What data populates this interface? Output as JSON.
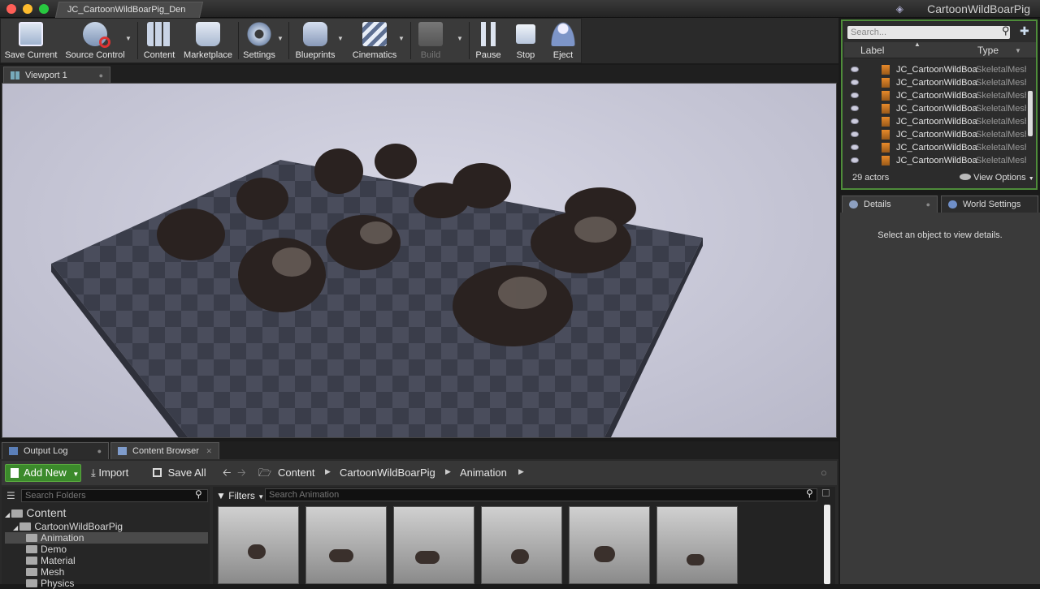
{
  "window": {
    "doc_tab": "JC_CartoonWildBoarPig_Den",
    "project_name": "CartoonWildBoarPig"
  },
  "toolbar": {
    "save_current": "Save Current",
    "source_control": "Source Control",
    "content": "Content",
    "marketplace": "Marketplace",
    "settings": "Settings",
    "blueprints": "Blueprints",
    "cinematics": "Cinematics",
    "build": "Build",
    "pause": "Pause",
    "stop": "Stop",
    "eject": "Eject"
  },
  "viewport": {
    "tab": "Viewport 1"
  },
  "bottom_tabs": {
    "output_log": "Output Log",
    "content_browser": "Content Browser"
  },
  "content_browser": {
    "add_new": "Add New",
    "import": "Import",
    "save_all": "Save All",
    "breadcrumbs": [
      "Content",
      "CartoonWildBoarPig",
      "Animation"
    ],
    "search_folders_placeholder": "Search Folders",
    "filters": "Filters",
    "search_assets_placeholder": "Search Animation",
    "folders": [
      {
        "label": "Content"
      },
      {
        "label": "CartoonWildBoarPig"
      },
      {
        "label": "Animation"
      },
      {
        "label": "Demo"
      },
      {
        "label": "Material"
      },
      {
        "label": "Mesh"
      },
      {
        "label": "Physics"
      }
    ]
  },
  "outliner": {
    "search_placeholder": "Search...",
    "col_label": "Label",
    "col_type": "Type",
    "rows": [
      {
        "name": "JC_CartoonWildBoarPig",
        "type": "SkeletalMeshActor"
      },
      {
        "name": "JC_CartoonWildBoarPig",
        "type": "SkeletalMeshActor"
      },
      {
        "name": "JC_CartoonWildBoarPig",
        "type": "SkeletalMeshActor"
      },
      {
        "name": "JC_CartoonWildBoarPig",
        "type": "SkeletalMeshActor"
      },
      {
        "name": "JC_CartoonWildBoarPig",
        "type": "SkeletalMeshActor"
      },
      {
        "name": "JC_CartoonWildBoarPig",
        "type": "SkeletalMeshActor"
      },
      {
        "name": "JC_CartoonWildBoarPig",
        "type": "SkeletalMeshActor"
      },
      {
        "name": "JC_CartoonWildBoarPig",
        "type": "SkeletalMeshActor"
      }
    ],
    "actor_count": "29 actors",
    "view_options": "View Options"
  },
  "details": {
    "tab_details": "Details",
    "tab_world_settings": "World Settings",
    "empty_message": "Select an object to view details."
  },
  "colors": {
    "accent_green": "#3b8a2b",
    "outliner_border": "#4e8c3a",
    "panel_bg": "#3a3a3a"
  }
}
